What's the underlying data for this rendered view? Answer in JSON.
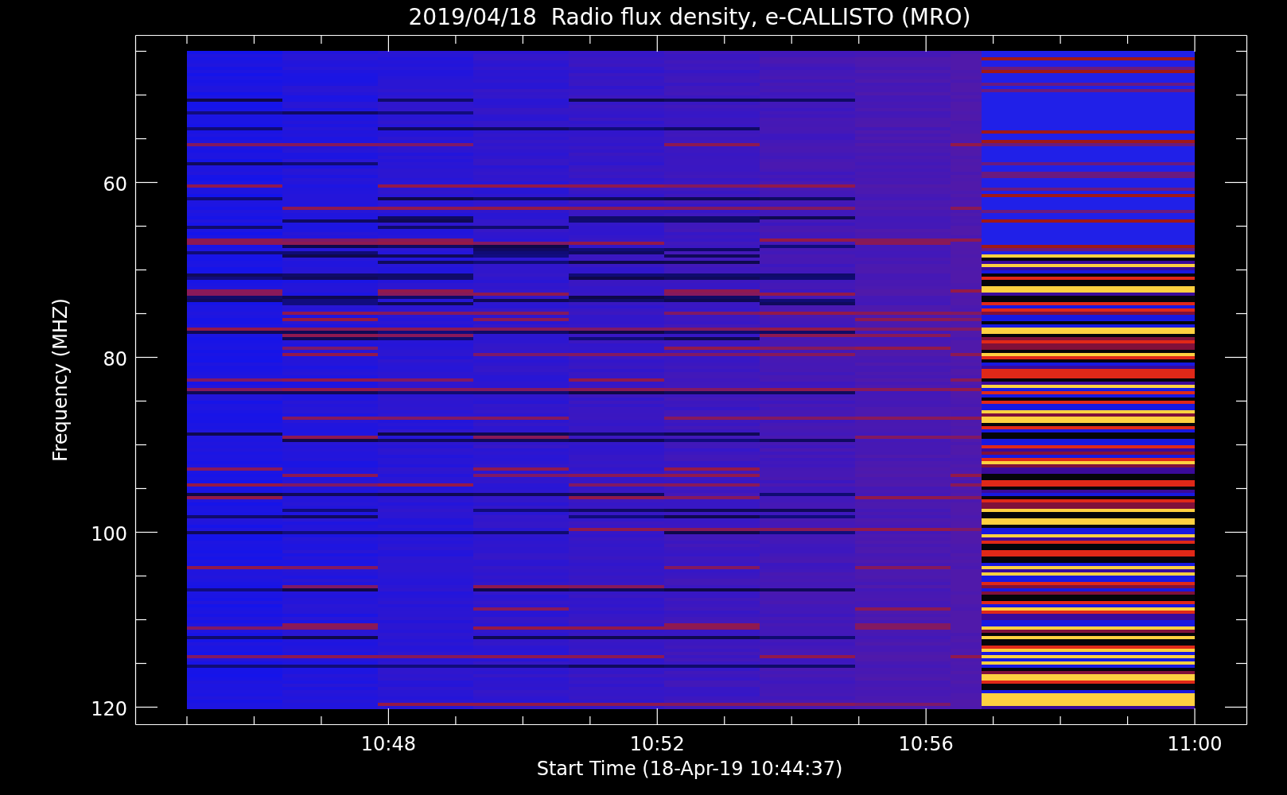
{
  "title": "2019/04/18  Radio flux density, e-CALLISTO (MRO)",
  "y_axis": {
    "label": "Frequency (MHZ)",
    "tick_labels": [
      "60",
      "80",
      "100",
      "120"
    ]
  },
  "x_axis": {
    "label": "Start Time (18-Apr-19 10:44:37)",
    "tick_labels": [
      "10:48",
      "10:52",
      "10:56",
      "11:00"
    ]
  }
}
